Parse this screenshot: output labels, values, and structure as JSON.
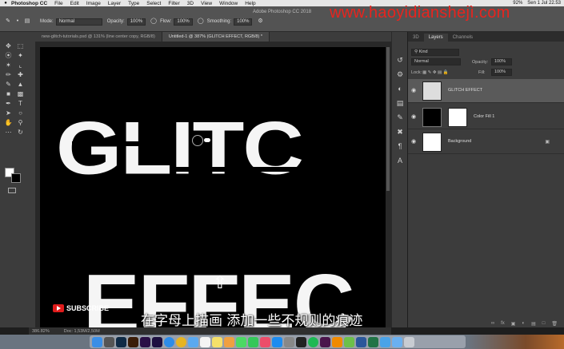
{
  "menubar": {
    "app_name": "Photoshop CC",
    "items": [
      "File",
      "Edit",
      "Image",
      "Layer",
      "Type",
      "Select",
      "Filter",
      "3D",
      "View",
      "Window",
      "Help"
    ],
    "battery": "92%",
    "datetime": "Sen 1 Jul 22.53"
  },
  "window_title": "Adobe Photoshop CC 2018",
  "watermark": "www.haoyidianshejì.com",
  "options": {
    "mode_label": "Mode:",
    "mode_value": "Normal",
    "opacity_label": "Opacity:",
    "opacity_value": "100%",
    "flow_label": "Flow:",
    "flow_value": "100%",
    "smoothing_label": "Smoothing:",
    "smoothing_value": "100%"
  },
  "tabs": [
    "new-glitch-tutorials.psd @ 131% (line center copy, RGB/8)",
    "Untitled-1 @ 387% (GLITCH EFFECT, RGB/8) *"
  ],
  "canvas": {
    "line1": "GLITC",
    "line2": "EFFEC"
  },
  "subscribe_label": "SUBSCRIBE",
  "subtitle": "在字母上描画 添加一些不规则的痕迹",
  "status": {
    "zoom": "386.82%",
    "doc": "Doc: 1,53M/2,50M"
  },
  "layers_panel": {
    "tabs": [
      "3D",
      "Layers",
      "Channels"
    ],
    "active_tab": "Layers",
    "kind_label": "Kind",
    "blend_mode": "Normal",
    "opacity_label": "Opacity:",
    "opacity_value": "100%",
    "lock_label": "Lock:",
    "fill_label": "Fill:",
    "fill_value": "100%",
    "layers": [
      {
        "name": "GLITCH EFFECT",
        "selected": true
      },
      {
        "name": "Color Fill 1",
        "selected": false
      },
      {
        "name": "Background",
        "selected": false
      }
    ]
  },
  "colors": {
    "accent_watermark": "#e8241e",
    "canvas_bg": "#000000",
    "panel_bg": "#3c3c3c"
  }
}
